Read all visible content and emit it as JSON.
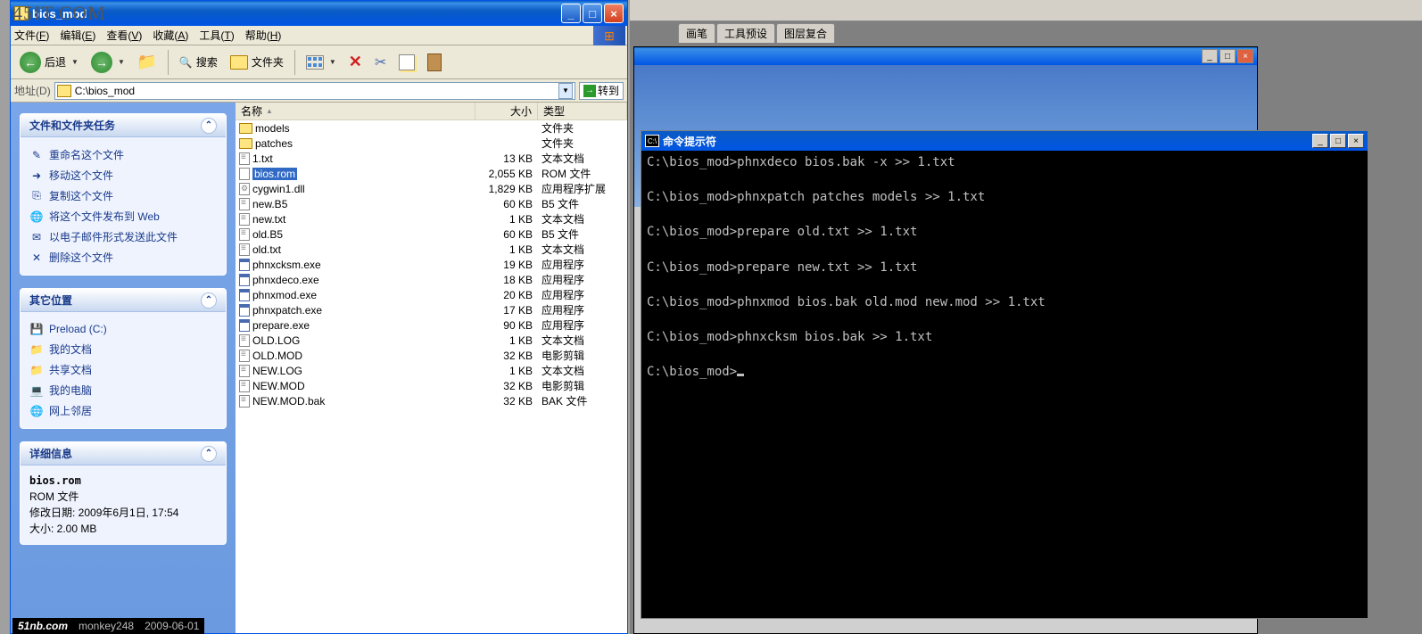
{
  "watermark": "45IT.COM",
  "footer": {
    "site": "51nb.com",
    "author": "monkey248",
    "date": "2009-06-01"
  },
  "explorer": {
    "title": "bios_mod",
    "menu": [
      {
        "label": "文件",
        "key": "F"
      },
      {
        "label": "编辑",
        "key": "E"
      },
      {
        "label": "查看",
        "key": "V"
      },
      {
        "label": "收藏",
        "key": "A"
      },
      {
        "label": "工具",
        "key": "T"
      },
      {
        "label": "帮助",
        "key": "H"
      }
    ],
    "toolbar": {
      "back": "后退",
      "search": "搜索",
      "folders": "文件夹"
    },
    "address": {
      "label": "地址",
      "key": "D",
      "path": "C:\\bios_mod",
      "go": "转到"
    },
    "columns": {
      "name": "名称",
      "size": "大小",
      "type": "类型"
    },
    "files": [
      {
        "icon": "folder",
        "name": "models",
        "size": "",
        "type": "文件夹"
      },
      {
        "icon": "folder",
        "name": "patches",
        "size": "",
        "type": "文件夹"
      },
      {
        "icon": "txt",
        "name": "1.txt",
        "size": "13 KB",
        "type": "文本文档"
      },
      {
        "icon": "rom",
        "name": "bios.rom",
        "size": "2,055 KB",
        "type": "ROM 文件",
        "selected": true
      },
      {
        "icon": "dll",
        "name": "cygwin1.dll",
        "size": "1,829 KB",
        "type": "应用程序扩展"
      },
      {
        "icon": "txt",
        "name": "new.B5",
        "size": "60 KB",
        "type": "B5 文件"
      },
      {
        "icon": "txt",
        "name": "new.txt",
        "size": "1 KB",
        "type": "文本文档"
      },
      {
        "icon": "txt",
        "name": "old.B5",
        "size": "60 KB",
        "type": "B5 文件"
      },
      {
        "icon": "txt",
        "name": "old.txt",
        "size": "1 KB",
        "type": "文本文档"
      },
      {
        "icon": "exe",
        "name": "phnxcksm.exe",
        "size": "19 KB",
        "type": "应用程序"
      },
      {
        "icon": "exe",
        "name": "phnxdeco.exe",
        "size": "18 KB",
        "type": "应用程序"
      },
      {
        "icon": "exe",
        "name": "phnxmod.exe",
        "size": "20 KB",
        "type": "应用程序"
      },
      {
        "icon": "exe",
        "name": "phnxpatch.exe",
        "size": "17 KB",
        "type": "应用程序"
      },
      {
        "icon": "exe",
        "name": "prepare.exe",
        "size": "90 KB",
        "type": "应用程序"
      },
      {
        "icon": "txt",
        "name": "OLD.LOG",
        "size": "1 KB",
        "type": "文本文档"
      },
      {
        "icon": "txt",
        "name": "OLD.MOD",
        "size": "32 KB",
        "type": "电影剪辑"
      },
      {
        "icon": "txt",
        "name": "NEW.LOG",
        "size": "1 KB",
        "type": "文本文档"
      },
      {
        "icon": "txt",
        "name": "NEW.MOD",
        "size": "32 KB",
        "type": "电影剪辑"
      },
      {
        "icon": "txt",
        "name": "NEW.MOD.bak",
        "size": "32 KB",
        "type": "BAK 文件"
      }
    ],
    "tasks": {
      "title": "文件和文件夹任务",
      "items": [
        {
          "icon": "✎",
          "label": "重命名这个文件"
        },
        {
          "icon": "➜",
          "label": "移动这个文件"
        },
        {
          "icon": "⎘",
          "label": "复制这个文件"
        },
        {
          "icon": "🌐",
          "label": "将这个文件发布到 Web"
        },
        {
          "icon": "✉",
          "label": "以电子邮件形式发送此文件"
        },
        {
          "icon": "✕",
          "label": "删除这个文件"
        }
      ]
    },
    "places": {
      "title": "其它位置",
      "items": [
        {
          "icon": "💾",
          "label": "Preload (C:)"
        },
        {
          "icon": "📁",
          "label": "我的文档"
        },
        {
          "icon": "📁",
          "label": "共享文档"
        },
        {
          "icon": "💻",
          "label": "我的电脑"
        },
        {
          "icon": "🌐",
          "label": "网上邻居"
        }
      ]
    },
    "details": {
      "title": "详细信息",
      "filename": "bios.rom",
      "filetype": "ROM 文件",
      "mod_label": "修改日期: ",
      "mod_value": "2009年6月1日, 17:54",
      "size_label": "大小: ",
      "size_value": "2.00 MB"
    }
  },
  "ps_tabs": [
    "画笔",
    "工具预设",
    "图层复合"
  ],
  "cmd": {
    "title": "命令提示符",
    "lines": [
      "C:\\bios_mod>phnxdeco bios.bak -x >> 1.txt",
      "",
      "C:\\bios_mod>phnxpatch patches models >> 1.txt",
      "",
      "C:\\bios_mod>prepare old.txt >> 1.txt",
      "",
      "C:\\bios_mod>prepare new.txt >> 1.txt",
      "",
      "C:\\bios_mod>phnxmod bios.bak old.mod new.mod >> 1.txt",
      "",
      "C:\\bios_mod>phnxcksm bios.bak >> 1.txt",
      "",
      "C:\\bios_mod>"
    ]
  }
}
